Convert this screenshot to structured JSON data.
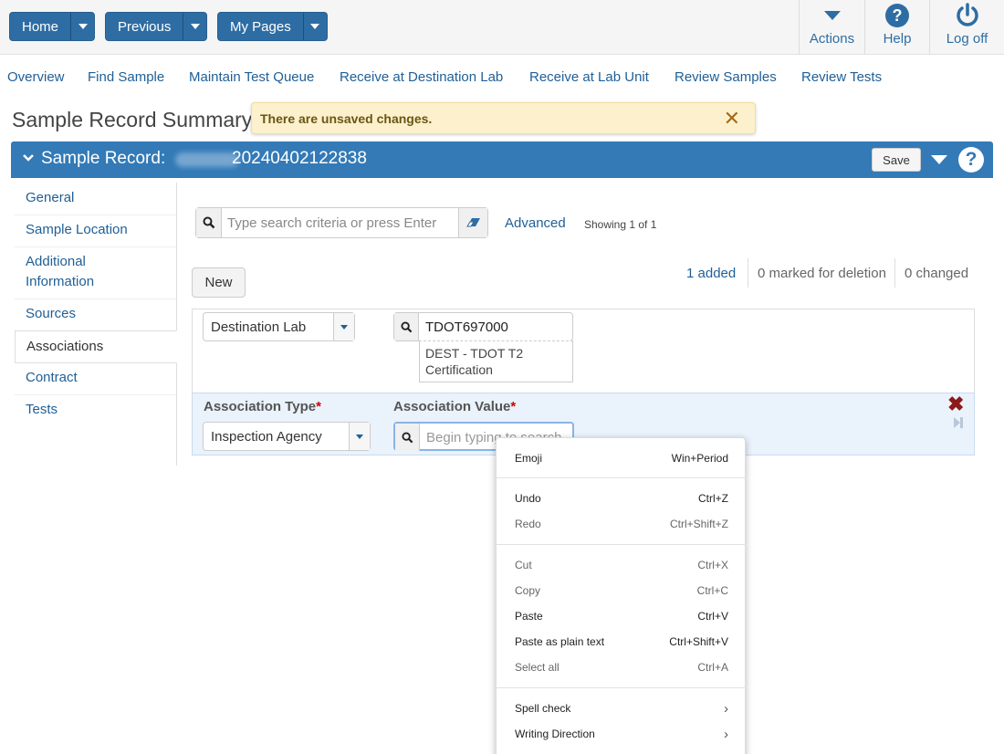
{
  "topnav": {
    "home_label": "Home",
    "previous_label": "Previous",
    "mypages_label": "My Pages",
    "actions_label": "Actions",
    "help_label": "Help",
    "logoff_label": "Log off"
  },
  "subnav": [
    "Overview",
    "Find Sample",
    "Maintain Test Queue",
    "Receive at Destination Lab",
    "Receive at Lab Unit",
    "Review Samples",
    "Review Tests"
  ],
  "page": {
    "title": "Sample Record Summary",
    "toast": "There are unsaved changes.",
    "toast_close": "✕"
  },
  "record": {
    "title": "Sample Record:",
    "number": "20240402122838",
    "save_label": "Save",
    "help_glyph": "?"
  },
  "sidebar": {
    "items": [
      "General",
      "Sample Location",
      "Additional",
      "Sources",
      "Associations",
      "Contract",
      "Tests"
    ],
    "additional_line2": "Information",
    "active": "Associations"
  },
  "search": {
    "placeholder": "Type search criteria or press Enter",
    "advanced_label": "Advanced",
    "showing": "Showing 1 of 1"
  },
  "grid": {
    "new_label": "New",
    "added": "1 added",
    "marked": "0 marked for deletion",
    "changed": "0 changed",
    "row1": {
      "type_value": "Destination Lab",
      "value": "TDOT697000",
      "desc_line1": "DEST - TDOT T2",
      "desc_line2": "Certification"
    },
    "row2": {
      "type_label": "Association Type",
      "value_label": "Association Value",
      "required_mark": "*",
      "type_value": "Inspection Agency",
      "value_placeholder": "Begin typing to search"
    }
  },
  "context_menu": {
    "items": [
      {
        "label": "Emoji",
        "shortcut": "Win+Period"
      },
      {
        "label": "Undo",
        "shortcut": "Ctrl+Z"
      },
      {
        "label": "Redo",
        "shortcut": "Ctrl+Shift+Z"
      },
      {
        "label": "Cut",
        "shortcut": "Ctrl+X"
      },
      {
        "label": "Copy",
        "shortcut": "Ctrl+C"
      },
      {
        "label": "Paste",
        "shortcut": "Ctrl+V"
      },
      {
        "label": "Paste as plain text",
        "shortcut": "Ctrl+Shift+V"
      },
      {
        "label": "Select all",
        "shortcut": "Ctrl+A"
      },
      {
        "label": "Spell check",
        "shortcut": "›"
      },
      {
        "label": "Writing Direction",
        "shortcut": "›"
      }
    ]
  },
  "colors": {
    "primary": "#337ab7",
    "link": "#1f5f96",
    "toast_bg": "#fcf1cc",
    "required": "#cc0000",
    "delete": "#8b1a1a"
  }
}
